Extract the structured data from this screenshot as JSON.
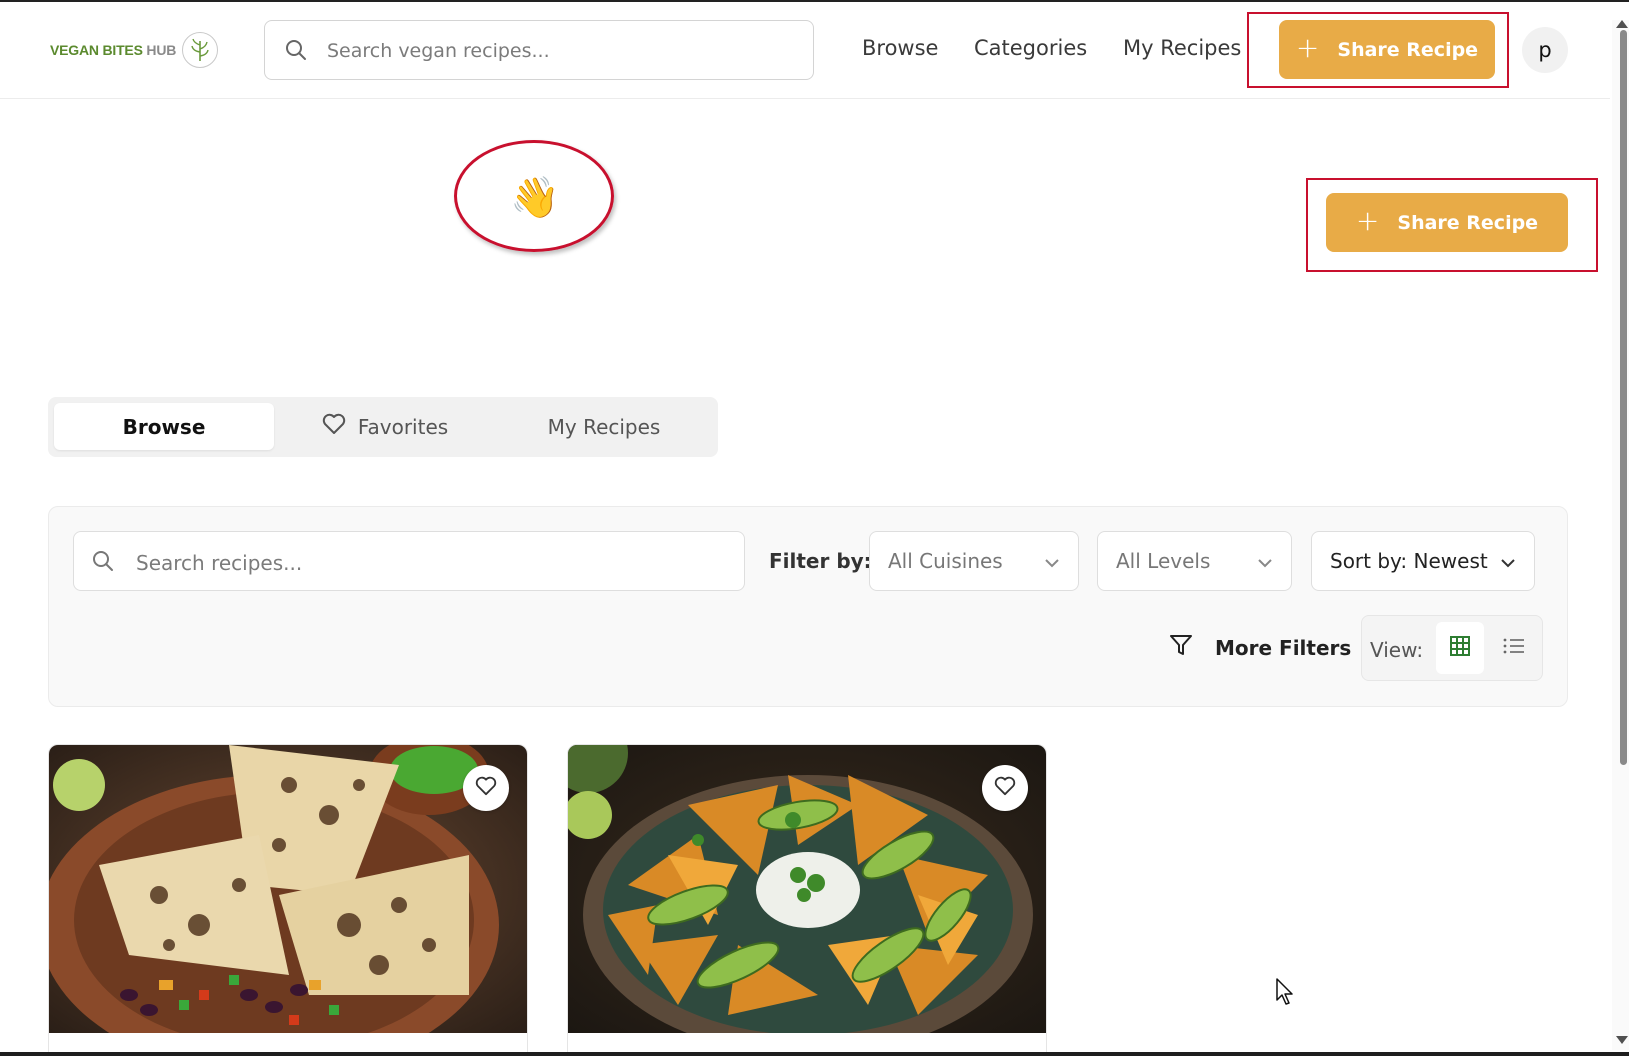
{
  "header": {
    "logo_text": "VEGAN BITES",
    "logo_suffix": "HUB",
    "search_placeholder": "Search vegan recipes...",
    "nav": [
      "Browse",
      "Categories",
      "My Recipes"
    ],
    "share_label": "Share Recipe",
    "avatar_letter": "p"
  },
  "hero": {
    "wave_emoji": "👋",
    "share_label": "Share Recipe"
  },
  "tabs": {
    "browse": "Browse",
    "favorites": "Favorites",
    "my_recipes": "My Recipes",
    "active": "Browse"
  },
  "filters": {
    "search_placeholder": "Search recipes...",
    "filter_label": "Filter by:",
    "cuisine": "All Cuisines",
    "level": "All Levels",
    "sort": "Sort by: Newest",
    "more_filters": "More Filters",
    "view_label": "View:",
    "view_mode": "grid"
  },
  "cards": [
    {
      "image": "quesadilla-photo",
      "favorited": false
    },
    {
      "image": "nachos-photo",
      "favorited": false
    }
  ],
  "colors": {
    "accent": "#e8ab47",
    "annotation": "#c8102e",
    "logo_green": "#5b8a2e",
    "grid_icon_green": "#2e7d32"
  }
}
